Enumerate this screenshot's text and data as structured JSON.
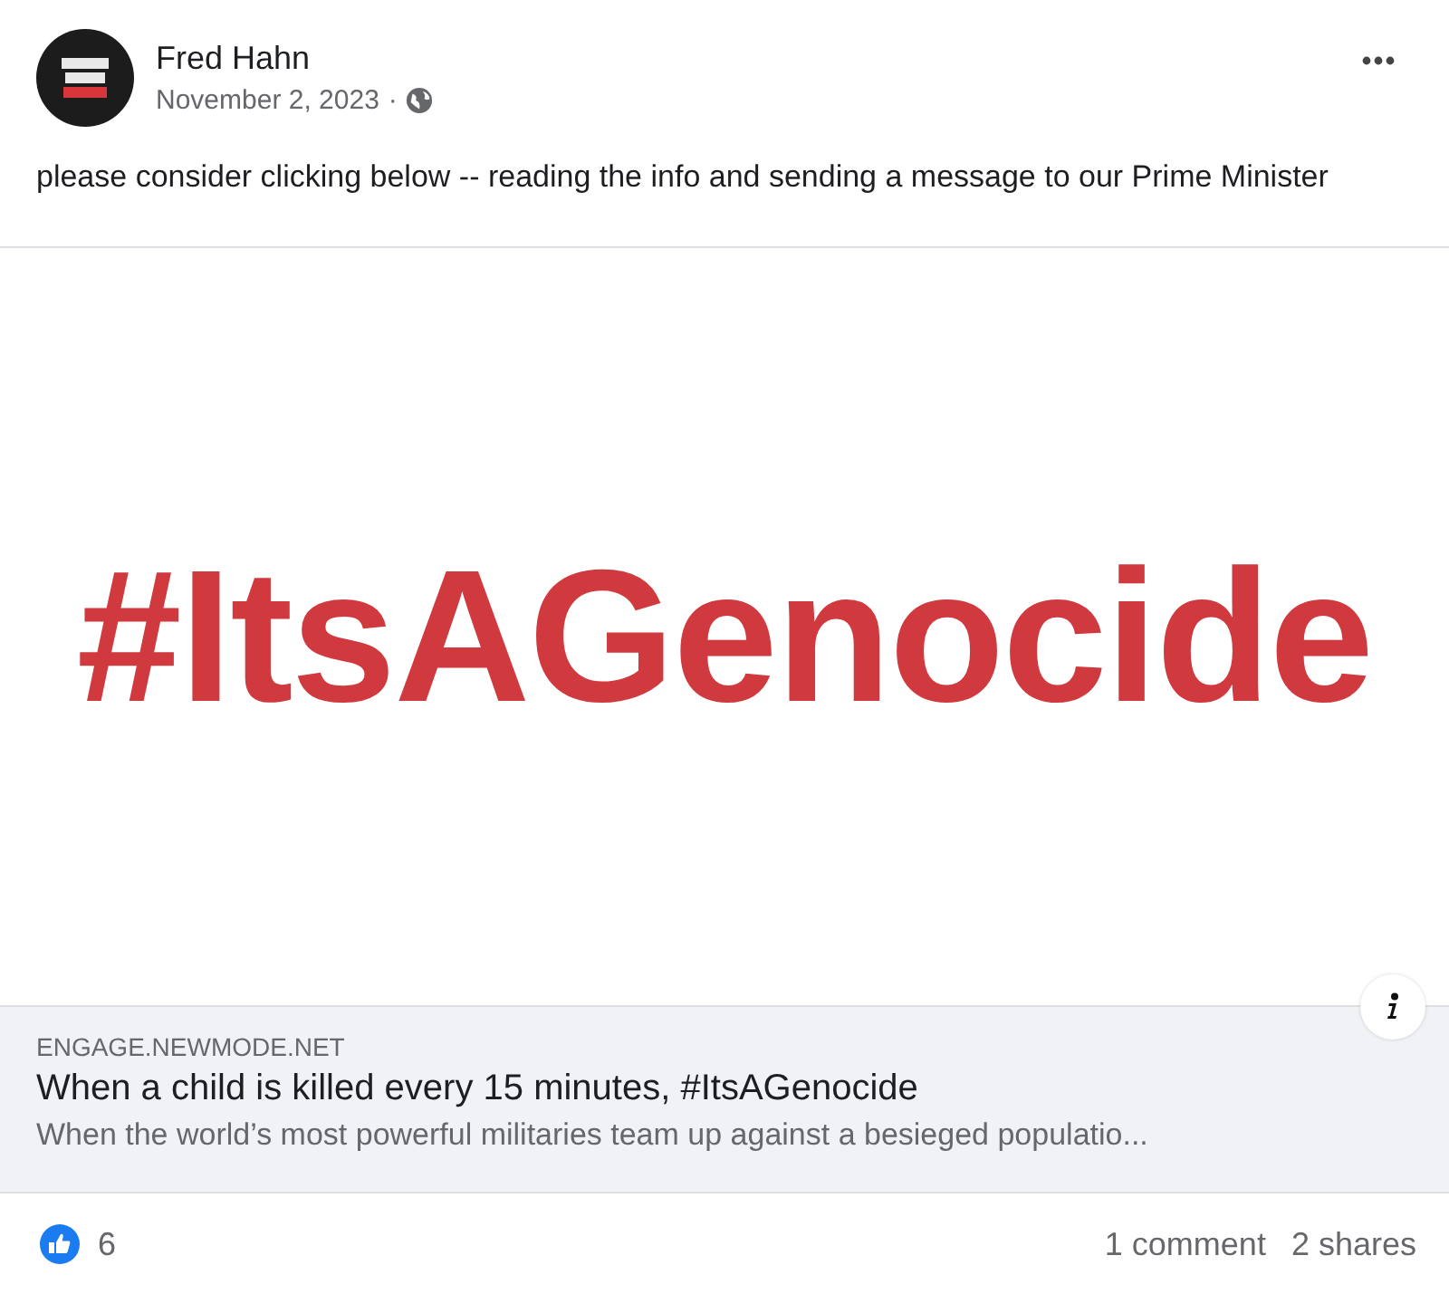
{
  "post": {
    "author": "Fred Hahn",
    "date": "November 2, 2023",
    "separator": "·",
    "text": "please consider clicking below -- reading the info and sending a message to our Prime Minister"
  },
  "link_preview": {
    "image_text": "#ItsAGenocide",
    "domain": "ENGAGE.NEWMODE.NET",
    "title": "When a child is killed every 15 minutes, #ItsAGenocide",
    "description": "When the world’s most powerful militaries team up against a besieged populatio..."
  },
  "footer": {
    "reactions": "6",
    "comments": "1 comment",
    "shares": "2 shares"
  }
}
